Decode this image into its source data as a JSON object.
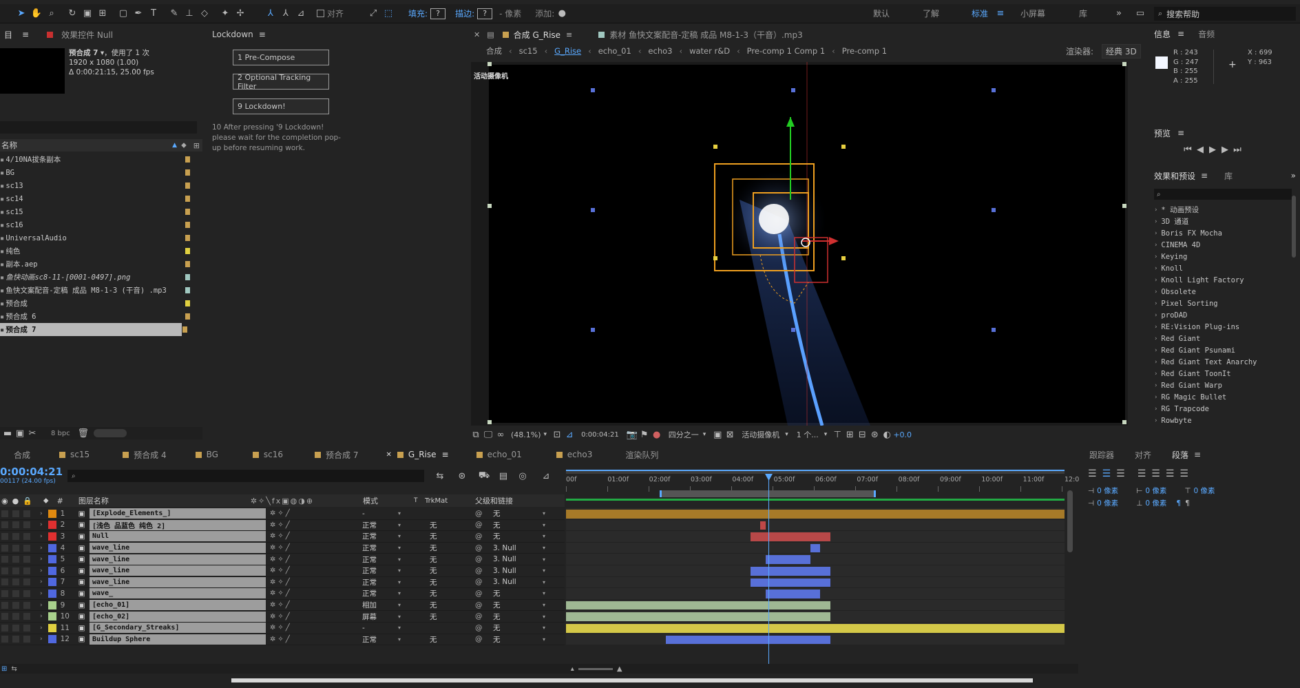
{
  "app": {
    "title": "Adobe After Effects"
  },
  "toolbar": {
    "snap_label": "对齐",
    "fill_label": "填充:",
    "fill_value": "?",
    "stroke_label": "描边:",
    "stroke_value": "?",
    "px_label": "- 像素",
    "add_label": "添加:",
    "workspaces": [
      "默认",
      "了解",
      "标准",
      "小屏幕",
      "库"
    ],
    "active_workspace": "标准",
    "search_placeholder": "搜索帮助"
  },
  "project": {
    "tab_left": "目",
    "effects_tab": "效果控件 Null",
    "selected_name": "预合成 7",
    "usage": "，使用了 1 次",
    "dims": "1920 x 1080 (1.00)",
    "duration": "Δ 0:00:21:15, 25.00 fps",
    "col_name": "名称",
    "items": [
      {
        "name": "4/10NA拔条副本",
        "color": "#c8a050"
      },
      {
        "name": "BG",
        "color": "#c8a050"
      },
      {
        "name": "sc13",
        "color": "#c8a050"
      },
      {
        "name": "sc14",
        "color": "#c8a050"
      },
      {
        "name": "sc15",
        "color": "#c8a050"
      },
      {
        "name": "sc16",
        "color": "#c8a050"
      },
      {
        "name": "UniversalAudio",
        "color": "#c8a050"
      },
      {
        "name": "纯色",
        "color": "#e0d040"
      },
      {
        "name": "副本.aep",
        "color": "#c8a050"
      },
      {
        "name": "鱼快动画sc8-11-[0001-0497].png",
        "color": "#a0c8c0"
      },
      {
        "name": "鱼快文案配音-定稿 成品 M8-1-3 (干音) .mp3",
        "color": "#a0c8c0"
      },
      {
        "name": "预合成",
        "color": "#e0d040"
      },
      {
        "name": "预合成 6",
        "color": "#c8a050"
      },
      {
        "name": "预合成 7",
        "color": "#c8a050"
      }
    ],
    "bpc": "8 bpc"
  },
  "lockdown": {
    "title": "Lockdown",
    "buttons": [
      "1 Pre-Compose",
      "2 Optional Tracking Filter",
      "9 Lockdown!"
    ],
    "note": "10 After pressing '9 Lockdown! please wait for the completion pop-up before resuming work."
  },
  "comp_viewer": {
    "tab_comp": "合成 G_Rise",
    "tab_footage": "素材 鱼快文案配音-定稿 成品 M8-1-3（干音）.mp3",
    "breadcrumbs": [
      "合成",
      "sc15",
      "G_Rise",
      "echo_01",
      "echo3",
      "water r&D",
      "Pre-comp 1 Comp 1",
      "Pre-comp 1"
    ],
    "active_crumb": "G_Rise",
    "renderer_label": "渲染器:",
    "renderer_value": "经典 3D",
    "camera_label": "活动摄像机",
    "zoom": "(48.1%)",
    "timecode": "0:00:04:21",
    "resolution": "四分之一",
    "view": "活动摄像机",
    "views_count": "1 个...",
    "exposure": "+0.0"
  },
  "info": {
    "tab": "信息",
    "tab2": "音频",
    "r": "R : 243",
    "g": "G : 247",
    "b": "B : 255",
    "a": "A : 255",
    "x": "X : 699",
    "y": "Y : 963"
  },
  "preview": {
    "title": "预览"
  },
  "effects": {
    "tab": "效果和预设",
    "tab2": "库",
    "items": [
      "* 动画预设",
      "3D 通道",
      "Boris FX Mocha",
      "CINEMA 4D",
      "Keying",
      "Knoll",
      "Knoll Light Factory",
      "Obsolete",
      "Pixel Sorting",
      "proDAD",
      "RE:Vision Plug-ins",
      "Red Giant",
      "Red Giant Psunami",
      "Red Giant Text Anarchy",
      "Red Giant ToonIt",
      "Red Giant Warp",
      "RG Magic Bullet",
      "RG Trapcode",
      "Rowbyte"
    ]
  },
  "timeline_tabs": [
    "合成",
    "sc15",
    "预合成 4",
    "BG",
    "sc16",
    "预合成 7",
    "G_Rise",
    "echo_01",
    "echo3",
    "渲染队列"
  ],
  "timeline_tab_colors": [
    "#c8a050",
    "#c8a050",
    "#c8a050",
    "#c8a050",
    "#c8a050",
    "#c8a050",
    "#c8a050",
    "#c8a050",
    "#c8a050"
  ],
  "timeline": {
    "timecode": "0:00:04:21",
    "fps": "00117 (24.00 fps)",
    "cols": {
      "num": "#",
      "name": "图层名称",
      "mode": "模式",
      "t": "T",
      "trkmat": "TrkMat",
      "parent": "父级和链接"
    },
    "ruler": [
      "00f",
      "01:00f",
      "02:00f",
      "03:00f",
      "04:00f",
      "05:00f",
      "06:00f",
      "07:00f",
      "08:00f",
      "09:00f",
      "10:00f",
      "11:00f",
      "12:0"
    ],
    "layers": [
      {
        "num": "1",
        "name": "[Explode_Elements_]",
        "color": "#e08a10",
        "mode": "-",
        "trk": "",
        "parent": "无",
        "bar": {
          "start": 0.0,
          "end": 1.0,
          "color": "#a77a28"
        }
      },
      {
        "num": "2",
        "name": "[浅色 品蓝色 纯色 2]",
        "color": "#e03030",
        "mode": "正常",
        "trk": "无",
        "parent": "无",
        "bar": {
          "start": 0.39,
          "end": 0.4,
          "color": "#c04848"
        }
      },
      {
        "num": "3",
        "name": "Null",
        "color": "#e03030",
        "mode": "正常",
        "trk": "无",
        "parent": "无",
        "bar": {
          "start": 0.37,
          "end": 0.53,
          "color": "#b84848"
        }
      },
      {
        "num": "4",
        "name": "wave_line",
        "color": "#5068e0",
        "mode": "正常",
        "trk": "无",
        "parent": "3. Null",
        "bar": {
          "start": 0.49,
          "end": 0.51,
          "color": "#5870d8"
        }
      },
      {
        "num": "5",
        "name": "wave_line",
        "color": "#5068e0",
        "mode": "正常",
        "trk": "无",
        "parent": "3. Null",
        "bar": {
          "start": 0.4,
          "end": 0.49,
          "color": "#5870d8"
        }
      },
      {
        "num": "6",
        "name": "wave_line",
        "color": "#5068e0",
        "mode": "正常",
        "trk": "无",
        "parent": "3. Null",
        "bar": {
          "start": 0.37,
          "end": 0.53,
          "color": "#5870d8"
        }
      },
      {
        "num": "7",
        "name": "wave_line",
        "color": "#5068e0",
        "mode": "正常",
        "trk": "无",
        "parent": "3. Null",
        "bar": {
          "start": 0.37,
          "end": 0.53,
          "color": "#5870d8"
        }
      },
      {
        "num": "8",
        "name": "wave_",
        "color": "#5068e0",
        "mode": "正常",
        "trk": "无",
        "parent": "无",
        "bar": {
          "start": 0.4,
          "end": 0.51,
          "color": "#5870d8"
        }
      },
      {
        "num": "9",
        "name": "[echo_01]",
        "color": "#a8d08c",
        "mode": "相加",
        "trk": "无",
        "parent": "无",
        "bar": {
          "start": 0.0,
          "end": 0.53,
          "color": "#9fb894"
        }
      },
      {
        "num": "10",
        "name": "[echo_02]",
        "color": "#a8d08c",
        "mode": "屏幕",
        "trk": "无",
        "parent": "无",
        "bar": {
          "start": 0.0,
          "end": 0.53,
          "color": "#9fb894"
        }
      },
      {
        "num": "11",
        "name": "[G_Secondary_Streaks]",
        "color": "#e0d040",
        "mode": "-",
        "trk": "",
        "parent": "无",
        "bar": {
          "start": 0.0,
          "end": 1.0,
          "color": "#d4c848"
        }
      },
      {
        "num": "12",
        "name": "Buildup Sphere",
        "color": "#5068e0",
        "mode": "正常",
        "trk": "无",
        "parent": "无",
        "bar": {
          "start": 0.2,
          "end": 0.53,
          "color": "#5870d8"
        }
      }
    ]
  },
  "right_panel": {
    "tabs": [
      "跟踪器",
      "对齐",
      "段落"
    ],
    "active": "段落",
    "px": "0 像素"
  }
}
